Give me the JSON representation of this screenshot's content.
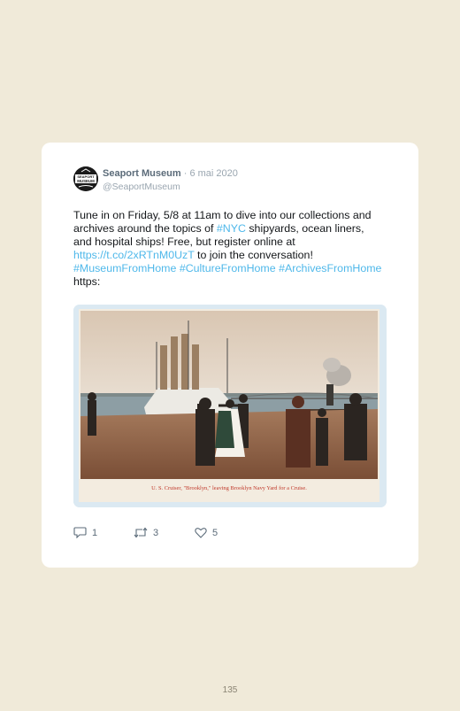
{
  "tweet": {
    "author_name": "Seaport Museum",
    "separator": "·",
    "date": "6 mai 2020",
    "handle": "@SeaportMuseum",
    "avatar_text_top": "SEAPORT",
    "avatar_text_bottom": "MUSEUM",
    "text_segments": [
      {
        "text": "Tune in on Friday, 5/8 at 11am to dive into our collections and archives around the topics of ",
        "link": false
      },
      {
        "text": "#NYC",
        "link": true
      },
      {
        "text": " shipyards, ocean liners, and hospital ships! Free, but register online at ",
        "link": false
      },
      {
        "text": "https://t.co/2xRTnM0UzT",
        "link": true
      },
      {
        "text": " to join the conversation! ",
        "link": false
      },
      {
        "text": "#MuseumFromHome",
        "link": true
      },
      {
        "text": " ",
        "link": false
      },
      {
        "text": "#CultureFromHome",
        "link": true
      },
      {
        "text": " ",
        "link": false
      },
      {
        "text": "#ArchivesFromHome",
        "link": true
      },
      {
        "text": " https:",
        "link": false
      }
    ],
    "photo_caption": "U. S. Cruiser, \"Brooklyn,\" leaving Brooklyn Navy Yard for a Cruise.",
    "actions": {
      "reply_count": "1",
      "retweet_count": "3",
      "like_count": "5"
    }
  },
  "icons": {
    "reply": "reply-icon",
    "retweet": "retweet-icon",
    "like": "heart-icon"
  },
  "colors": {
    "page_background": "#f0ead9",
    "link": "#4fb8ea",
    "caption_red": "#c0392b"
  },
  "page_number": "135"
}
